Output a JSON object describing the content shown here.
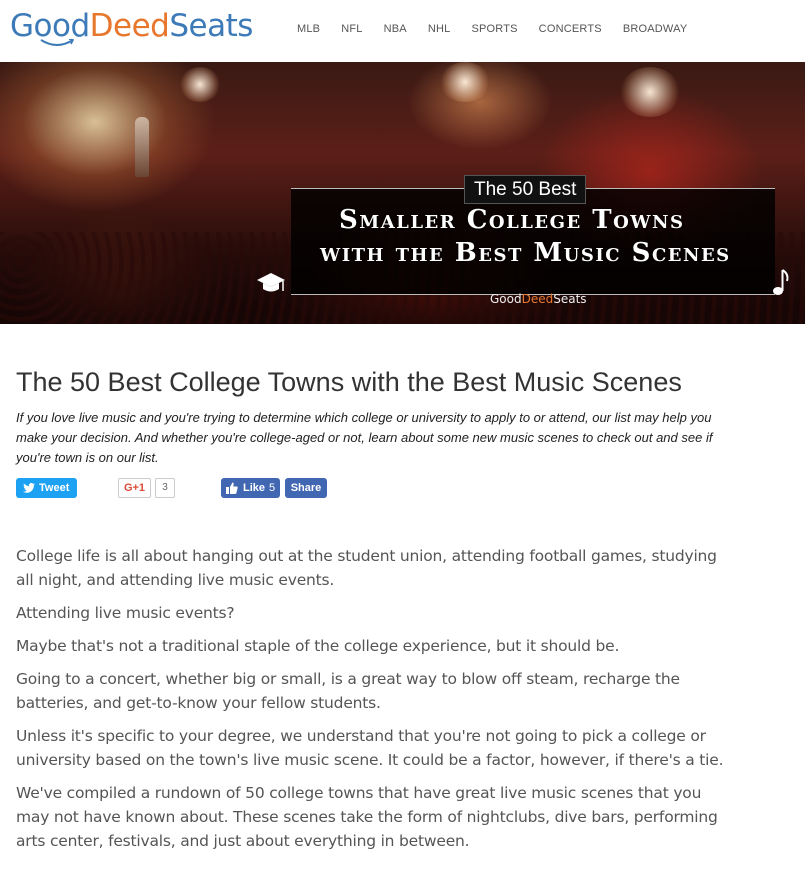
{
  "logo": {
    "part1": "Good",
    "part2": "Deed",
    "part3": "Seats"
  },
  "nav": {
    "items": [
      "MLB",
      "NFL",
      "NBA",
      "NHL",
      "SPORTS",
      "CONCERTS",
      "BROADWAY"
    ]
  },
  "hero": {
    "badge": "The 50 Best",
    "title_line1": "Smaller College Towns",
    "title_line2": "with the Best Music Scenes",
    "brand_part1": "Good",
    "brand_part2": "Deed",
    "brand_part3": "Seats"
  },
  "article": {
    "title": "The 50 Best College Towns with the Best Music Scenes",
    "intro": "If you love live music and you're trying to determine which college or university to apply to or attend, our list may help you make your decision. And whether you're college-aged or not, learn about some new music scenes to check out and see if you're town is on our list.",
    "share": {
      "tweet_label": "Tweet",
      "gplus_label": "G+1",
      "gplus_count": "3",
      "like_label": "Like",
      "like_count": "5",
      "share_label": "Share"
    },
    "paragraphs": [
      "College life is all about hanging out at the student union, attending football games, studying all night, and attending live music events.",
      "Attending live music events?",
      "Maybe that's not a traditional staple of the college experience, but it should be.",
      "Going to a concert, whether big or small, is a great way to blow off steam, recharge the batteries, and get-to-know your fellow students.",
      "Unless it's specific to your degree, we understand that you're not going to pick a college or university based on the town's live music scene.  It could be a factor, however, if there's a tie.",
      "We've compiled a rundown of 50 college towns that have great live music scenes that you may not have known about.  These scenes take the form of nightclubs, dive bars, performing arts center, festivals, and just about everything in between."
    ]
  },
  "colors": {
    "logo_blue": "#3d7ab8",
    "logo_orange": "#e8772e",
    "twitter": "#1da1f2",
    "facebook": "#4267b2",
    "gplus": "#dd4b39"
  }
}
